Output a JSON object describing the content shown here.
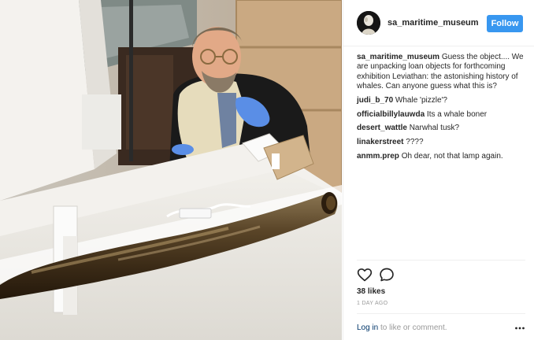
{
  "photo": {
    "icon": "museum-photo",
    "alt": ""
  },
  "account": {
    "username": "sa_maritime_museum",
    "follow_label": "Follow",
    "accent": "#3897f0"
  },
  "caption": {
    "author": "sa_maritime_museum",
    "text": "Guess the object.... We are unpacking loan objects for forthcoming exhibition Leviathan: the astonishing history of whales. Can anyone guess what this is?"
  },
  "comments": [
    {
      "author": "judi_b_70",
      "text": "Whale 'pizzle'?"
    },
    {
      "author": "officialbillylauwda",
      "text": "Its a whale boner"
    },
    {
      "author": "desert_wattle",
      "text": "Narwhal tusk?"
    },
    {
      "author": "linakerstreet",
      "text": "????"
    },
    {
      "author": "anmm.prep",
      "text": "Oh dear, not that lamp again."
    }
  ],
  "actions": {
    "like_icon": "heart-icon",
    "comment_icon": "comment-bubble-icon"
  },
  "stats": {
    "likes": "38 likes",
    "time_ago": "1 DAY AGO"
  },
  "footer": {
    "login_label": "Log in",
    "login_suffix": " to like or comment.",
    "more_icon": "more-options-icon"
  }
}
